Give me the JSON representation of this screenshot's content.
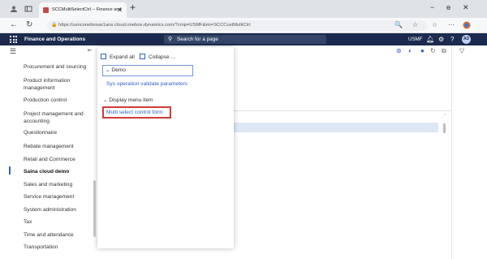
{
  "browser": {
    "tab_title": "SCCMultiSelectCtrl -- Finance and",
    "new_tab": "+",
    "url": "https://usnconeboxax1aos.cloud.onebox.dynamics.com/?cmp=USMF&mi=SCCCustMultiCtrl",
    "window_controls": [
      "−",
      "ɵ",
      "✕"
    ]
  },
  "app": {
    "name": "Finance and Operations",
    "search_placeholder": "Search for a page",
    "company": "USMF",
    "avatar_initials": "AD"
  },
  "nav": {
    "items": [
      "Procurement and sourcing",
      "Product information management",
      "Production control",
      "Project management and accounting",
      "Questionnaire",
      "Rebate management",
      "Retail and Commerce",
      "Saina cloud demo",
      "Sales and marketing",
      "Service management",
      "System administration",
      "Tax",
      "Time and attendance",
      "Transportation"
    ],
    "active_item": "Saina cloud demo"
  },
  "flyout": {
    "expand_all": "Expand all",
    "collapse": "Collapse ...",
    "demo_group": "Demo",
    "demo_link": "Sys operation validate parameters",
    "display_group": "Display menu item",
    "display_link": "Multi select control form"
  },
  "colors": {
    "header_bg": "#1b2a4e",
    "link": "#2f5fc9",
    "highlight_border": "#d23a3a",
    "selected_row": "#dde7f6"
  }
}
